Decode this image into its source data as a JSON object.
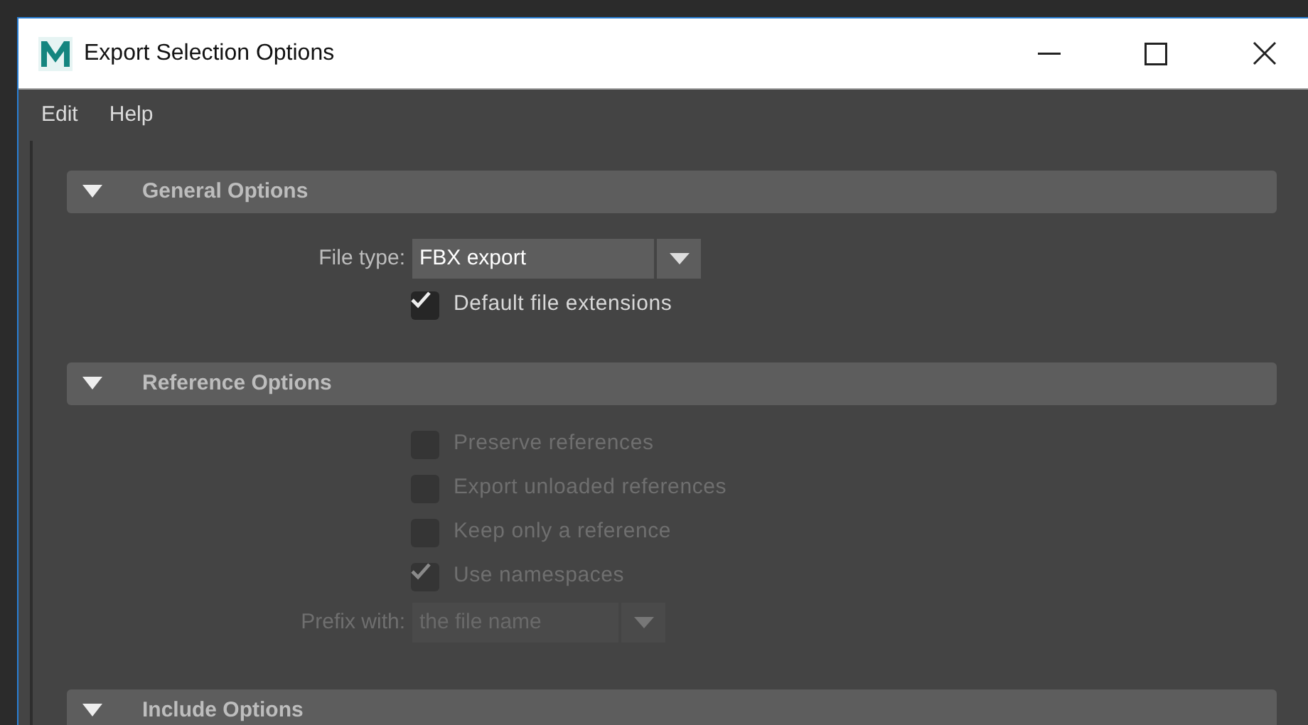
{
  "window": {
    "title": "Export Selection Options"
  },
  "menu": [
    "Edit",
    "Help"
  ],
  "sections": [
    {
      "title": "General Options",
      "expanded": true,
      "rows": [
        {
          "kind": "dropdown",
          "label": "File type:",
          "value": "FBX export",
          "disabled": false
        },
        {
          "kind": "checkbox",
          "label": "Default file extensions",
          "checked": true,
          "disabled": false
        }
      ]
    },
    {
      "title": "Reference Options",
      "expanded": true,
      "rows": [
        {
          "kind": "checkbox",
          "label": "Preserve references",
          "checked": false,
          "disabled": true
        },
        {
          "kind": "checkbox",
          "label": "Export unloaded references",
          "checked": false,
          "disabled": true
        },
        {
          "kind": "checkbox",
          "label": "Keep only a reference",
          "checked": false,
          "disabled": true
        },
        {
          "kind": "checkbox",
          "label": "Use namespaces",
          "checked": true,
          "disabled": true
        },
        {
          "kind": "dropdown",
          "label": "Prefix with:",
          "value": "the file name",
          "disabled": true
        }
      ]
    },
    {
      "title": "Include Options",
      "expanded": true
    }
  ]
}
